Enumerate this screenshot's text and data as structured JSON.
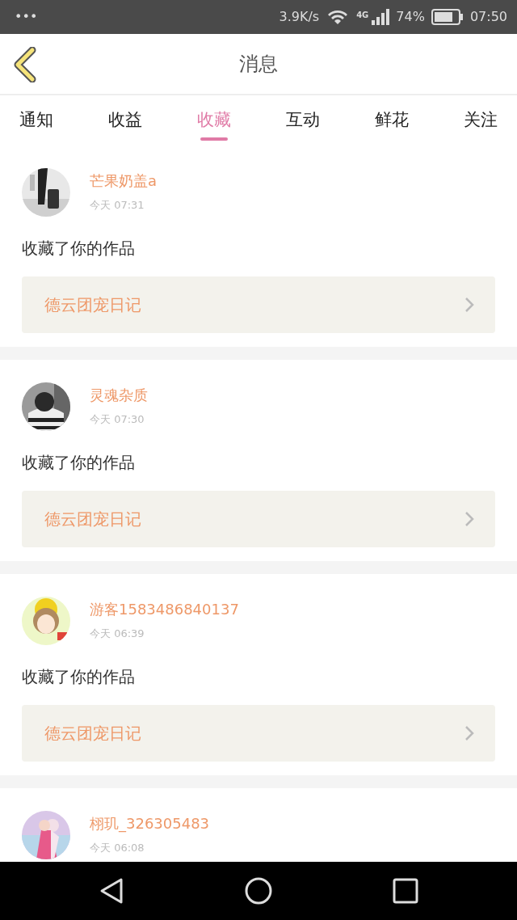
{
  "status_bar": {
    "menu": "•••",
    "speed": "3.9K/s",
    "network": "4G",
    "battery": "74%",
    "time": "07:50"
  },
  "header": {
    "title": "消息"
  },
  "tabs": [
    {
      "label": "通知",
      "selected": false
    },
    {
      "label": "收益",
      "selected": false
    },
    {
      "label": "收藏",
      "selected": true
    },
    {
      "label": "互动",
      "selected": false
    },
    {
      "label": "鲜花",
      "selected": false
    },
    {
      "label": "关注",
      "selected": false
    }
  ],
  "messages": [
    {
      "user": "芒果奶盖a",
      "time": "今天 07:31",
      "action": "收藏了你的作品",
      "work": "德云团宠日记"
    },
    {
      "user": "灵魂杂质",
      "time": "今天 07:30",
      "action": "收藏了你的作品",
      "work": "德云团宠日记"
    },
    {
      "user": "游客1583486840137",
      "time": "今天 06:39",
      "action": "收藏了你的作品",
      "work": "德云团宠日记"
    },
    {
      "user": "栩玑_326305483",
      "time": "今天 06:08"
    }
  ]
}
